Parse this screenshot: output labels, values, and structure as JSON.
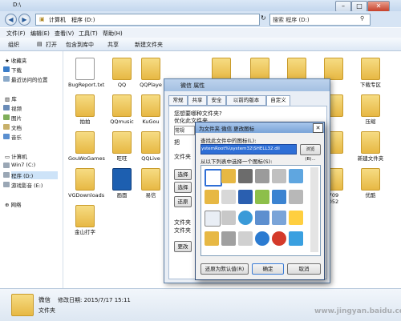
{
  "window": {
    "title": "D:\\"
  },
  "address": {
    "path": [
      "计算机",
      "程序 (D:)"
    ]
  },
  "search": {
    "placeholder": "搜索 程序 (D:)"
  },
  "menu": [
    "文件(F)",
    "编辑(E)",
    "查看(V)",
    "工具(T)",
    "帮助(H)"
  ],
  "toolbar": [
    "组织",
    "打开",
    "包含到库中",
    "共享",
    "新建文件夹"
  ],
  "nav": {
    "favorites": "收藏夹",
    "fav_items": [
      "下载",
      "最近访问的位置"
    ],
    "libraries": "库",
    "lib_items": [
      "视频",
      "图片",
      "文档",
      "音乐"
    ],
    "computer": "计算机",
    "comp_items": [
      "Win7 (C:)",
      "程序 (D:)",
      "游戏影音 (E:)"
    ],
    "network": "网络"
  },
  "files": [
    {
      "name": "BugReport.txt",
      "kind": "doc"
    },
    {
      "name": "QQ",
      "kind": "folder"
    },
    {
      "name": "QQPlaye",
      "kind": "folder"
    },
    {
      "name": "下载专区",
      "kind": "folder"
    },
    {
      "name": "拍拍",
      "kind": "folder"
    },
    {
      "name": "QQmusic",
      "kind": "folder"
    },
    {
      "name": "KuGou",
      "kind": "folder"
    },
    {
      "name": "压缩",
      "kind": "folder"
    },
    {
      "name": "GouWoGames",
      "kind": "folder"
    },
    {
      "name": "旺旺",
      "kind": "folder"
    },
    {
      "name": "QQLive",
      "kind": "folder"
    },
    {
      "name": "新建文件夹",
      "kind": "folder"
    },
    {
      "name": "VGDownloads",
      "kind": "folder"
    },
    {
      "name": "画面",
      "kind": "app"
    },
    {
      "name": "易信",
      "kind": "folder"
    },
    {
      "name": "优酷",
      "kind": "folder"
    },
    {
      "name": "金山打字",
      "kind": "folder"
    }
  ],
  "status": {
    "name": "微信",
    "modified": "修改日期: 2015/7/17 15:11",
    "type": "文件夹"
  },
  "props": {
    "title": "微信 属性",
    "tabs": [
      "常规",
      "共享",
      "安全",
      "以前的版本",
      "自定义"
    ],
    "lines": [
      "您想要哪种文件夹?",
      "优化此文件夹",
      "常规",
      "把",
      "文件夹",
      "选择",
      "选择",
      "还原",
      "文件夹",
      "文件夹",
      "更改"
    ]
  },
  "change": {
    "title": "为文件夹 微信 更改图标",
    "find_label": "查找此文件中的图标(L):",
    "path": "ystemRoot%\\system32\\SHELL32.dll",
    "browse": "浏览(B)...",
    "select_label": "从以下列表中选择一个图标(S):",
    "restore": "还原为默认值(R)",
    "ok": "确定",
    "cancel": "取消"
  },
  "watermark": "www.jingyan.baidu.com",
  "side_labels": [
    "709",
    "052"
  ],
  "colors": {
    "title": "#c3d7ee",
    "selection": "#2f6fd6",
    "folder": "#e7b844"
  }
}
